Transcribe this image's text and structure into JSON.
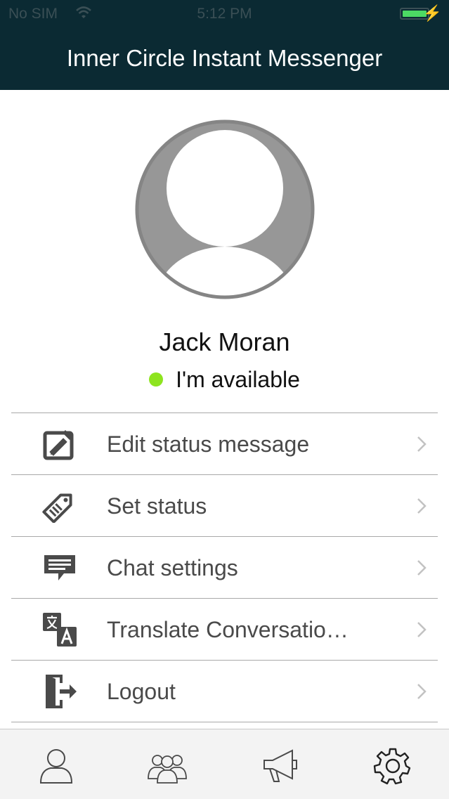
{
  "status_bar": {
    "carrier": "No SIM",
    "wifi_icon": "wifi-icon",
    "time": "5:12 PM",
    "battery_color": "#4cd964"
  },
  "nav": {
    "title": "Inner Circle Instant Messenger"
  },
  "profile": {
    "name": "Jack Moran",
    "status_text": "I'm available",
    "status_color": "#8ee41f"
  },
  "menu": {
    "items": [
      {
        "label": "Edit status message",
        "icon": "edit-icon"
      },
      {
        "label": "Set status",
        "icon": "tag-icon"
      },
      {
        "label": "Chat settings",
        "icon": "chat-bubble-icon"
      },
      {
        "label": "Translate Conversatio…",
        "icon": "translate-icon"
      },
      {
        "label": "Logout",
        "icon": "logout-icon"
      }
    ]
  },
  "tabbar": {
    "tabs": [
      "contacts-icon",
      "groups-icon",
      "broadcast-icon",
      "settings-icon"
    ]
  },
  "colors": {
    "nav_background": "#0b2a33",
    "text_muted": "#4a4a4a"
  }
}
